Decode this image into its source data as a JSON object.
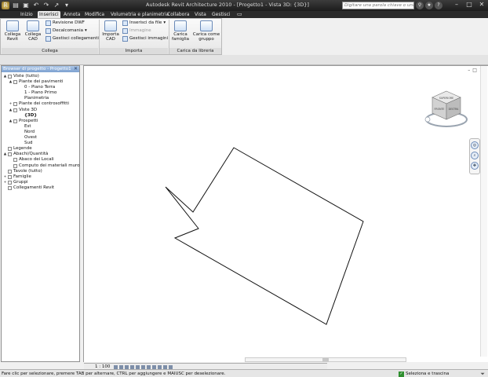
{
  "window": {
    "title": "Autodesk Revit Architecture 2010 - [Progetto1 - Vista 3D: {3D}]",
    "search_placeholder": "Digitare una parola chiave o una frase",
    "controls": [
      "–",
      "□",
      "✕"
    ],
    "title_icons": [
      "⚲",
      "★",
      "?"
    ]
  },
  "ribbon": {
    "tabs": [
      {
        "label": "Inizio",
        "active": false
      },
      {
        "label": "Inserisci",
        "active": true
      },
      {
        "label": "Annota",
        "active": false
      },
      {
        "label": "Modifica",
        "active": false
      },
      {
        "label": "Volumetria e planimetria",
        "active": false
      },
      {
        "label": "Collabora",
        "active": false
      },
      {
        "label": "Vista",
        "active": false
      },
      {
        "label": "Gestisci",
        "active": false
      }
    ],
    "collega": {
      "collega_revit": "Collega Revit",
      "collega_cad": "Collega CAD",
      "revisione_dwf": "Revisione DWF",
      "decalcomania": "Decalcomania",
      "gestisci_collegamenti": "Gestisci collegamenti",
      "label": "Collega"
    },
    "importa": {
      "importa_cad": "Importa CAD",
      "inserisci_da_file": "Inserisci da file",
      "immagine": "Immagine",
      "gestisci_immagini": "Gestisci immagini",
      "label": "Importa"
    },
    "libreria": {
      "carica_famiglia": "Carica famiglia",
      "carica_come_gruppo": "Carica come gruppo",
      "label": "Carica da libreria"
    }
  },
  "browser": {
    "title": "Browser di progetto - Progetto1",
    "close": "✕",
    "tree": [
      {
        "label": "Viste (tutto)",
        "toggle": "▲"
      },
      {
        "label": "Piante dei pavimenti",
        "toggle": "▲"
      },
      {
        "label": "0 - Piano Terra",
        "toggle": ""
      },
      {
        "label": "1 - Piano Primo",
        "toggle": ""
      },
      {
        "label": "Planimetria",
        "toggle": ""
      },
      {
        "label": "Piante dei controsoffitti",
        "toggle": "+"
      },
      {
        "label": "Viste 3D",
        "toggle": "▲"
      },
      {
        "label": "{3D}",
        "toggle": ""
      },
      {
        "label": "Prospetti",
        "toggle": "▲"
      },
      {
        "label": "Est",
        "toggle": ""
      },
      {
        "label": "Nord",
        "toggle": ""
      },
      {
        "label": "Ovest",
        "toggle": ""
      },
      {
        "label": "Sud",
        "toggle": ""
      },
      {
        "label": "Legende",
        "toggle": ""
      },
      {
        "label": "Abachi/Quantità",
        "toggle": "▲"
      },
      {
        "label": "Abaco dei Locali",
        "toggle": ""
      },
      {
        "label": "Computo dei materiali muro",
        "toggle": ""
      },
      {
        "label": "Tavole (tutto)",
        "toggle": ""
      },
      {
        "label": "Famiglie",
        "toggle": "+"
      },
      {
        "label": "Gruppi",
        "toggle": "+"
      },
      {
        "label": "Collegamenti Revit",
        "toggle": ""
      }
    ]
  },
  "viewport": {
    "scale": "1 : 100",
    "viewcube": {
      "front": "FRONTE",
      "right": "DESTRA",
      "top": "SUPERIORE"
    },
    "controls": [
      "–",
      "□",
      "✕"
    ]
  },
  "status": {
    "message": "Fare clic per selezionare, premere TAB per alternare, CTRL per aggiungere e MAIUSC per deselezionare.",
    "select_drag": "Seleziona e trascina"
  }
}
